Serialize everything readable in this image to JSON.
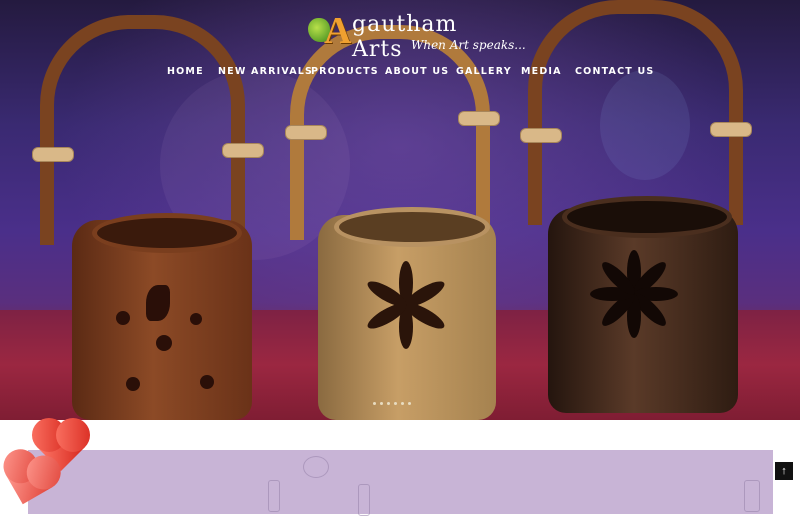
{
  "logo": {
    "letter": "A",
    "name": "gautham Arts",
    "tagline": "When Art speaks..."
  },
  "nav": {
    "items": [
      {
        "label": "HOME"
      },
      {
        "label": "NEW ARRIVALS"
      },
      {
        "label": "PRODUCTS"
      },
      {
        "label": "ABOUT US"
      },
      {
        "label": "GALLERY"
      },
      {
        "label": "MEDIA"
      },
      {
        "label": "CONTACT US"
      }
    ]
  },
  "slider": {
    "dot_count": 6
  },
  "back_to_top": {
    "glyph": "↑"
  },
  "colors": {
    "accent": "#f0a030",
    "banner": "#c8b4d6",
    "hero_bg": "#3a2a72"
  }
}
